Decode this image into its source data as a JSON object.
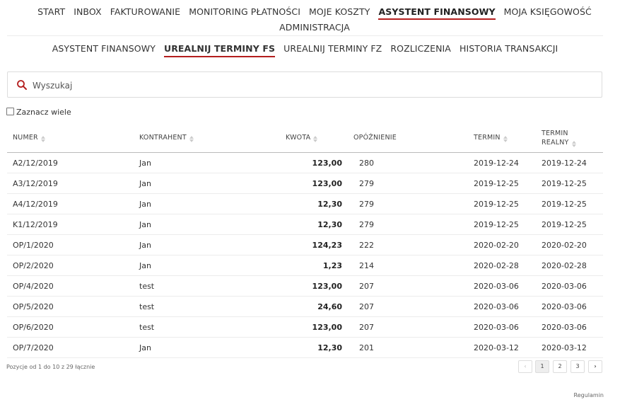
{
  "top_nav": [
    "START",
    "INBOX",
    "FAKTUROWANIE",
    "MONITORING PŁATNOŚCI",
    "MOJE KOSZTY",
    "ASYSTENT FINANSOWY",
    "MOJA KSIĘGOWOŚĆ",
    "ADMINISTRACJA"
  ],
  "top_nav_active": 5,
  "sub_nav": [
    "ASYSTENT FINANSOWY",
    "UREALNIJ TERMINY FS",
    "UREALNIJ TERMINY FZ",
    "ROZLICZENIA",
    "HISTORIA TRANSAKCJI"
  ],
  "sub_nav_active": 1,
  "search": {
    "placeholder": "Wyszukaj",
    "value": ""
  },
  "select_many_label": "Zaznacz wiele",
  "accent_color": "#b41e1e",
  "columns": {
    "numer": "NUMER",
    "kontrahent": "KONTRAHENT",
    "kwota": "KWOTA",
    "opoznienie": "OPÓŹNIENIE",
    "termin": "TERMIN",
    "termin_realny_1": "TERMIN",
    "termin_realny_2": "REALNY"
  },
  "rows": [
    {
      "numer": "A2/12/2019",
      "kontrahent": "Jan",
      "kwota": "123,00",
      "opoznienie": "280",
      "termin": "2019-12-24",
      "termin_realny": "2019-12-24"
    },
    {
      "numer": "A3/12/2019",
      "kontrahent": "Jan",
      "kwota": "123,00",
      "opoznienie": "279",
      "termin": "2019-12-25",
      "termin_realny": "2019-12-25"
    },
    {
      "numer": "A4/12/2019",
      "kontrahent": "Jan",
      "kwota": "12,30",
      "opoznienie": "279",
      "termin": "2019-12-25",
      "termin_realny": "2019-12-25"
    },
    {
      "numer": "K1/12/2019",
      "kontrahent": "Jan",
      "kwota": "12,30",
      "opoznienie": "279",
      "termin": "2019-12-25",
      "termin_realny": "2019-12-25"
    },
    {
      "numer": "OP/1/2020",
      "kontrahent": "Jan",
      "kwota": "124,23",
      "opoznienie": "222",
      "termin": "2020-02-20",
      "termin_realny": "2020-02-20"
    },
    {
      "numer": "OP/2/2020",
      "kontrahent": "Jan",
      "kwota": "1,23",
      "opoznienie": "214",
      "termin": "2020-02-28",
      "termin_realny": "2020-02-28"
    },
    {
      "numer": "OP/4/2020",
      "kontrahent": "test",
      "kwota": "123,00",
      "opoznienie": "207",
      "termin": "2020-03-06",
      "termin_realny": "2020-03-06"
    },
    {
      "numer": "OP/5/2020",
      "kontrahent": "test",
      "kwota": "24,60",
      "opoznienie": "207",
      "termin": "2020-03-06",
      "termin_realny": "2020-03-06"
    },
    {
      "numer": "OP/6/2020",
      "kontrahent": "test",
      "kwota": "123,00",
      "opoznienie": "207",
      "termin": "2020-03-06",
      "termin_realny": "2020-03-06"
    },
    {
      "numer": "OP/7/2020",
      "kontrahent": "Jan",
      "kwota": "12,30",
      "opoznienie": "201",
      "termin": "2020-03-12",
      "termin_realny": "2020-03-12"
    }
  ],
  "pagination": {
    "info": "Pozycje od 1 do 10 z 29 łącznie",
    "prev": "‹",
    "pages": [
      "1",
      "2",
      "3"
    ],
    "next": "›",
    "current": "1"
  },
  "footer": {
    "regulamin": "Regulamin"
  }
}
